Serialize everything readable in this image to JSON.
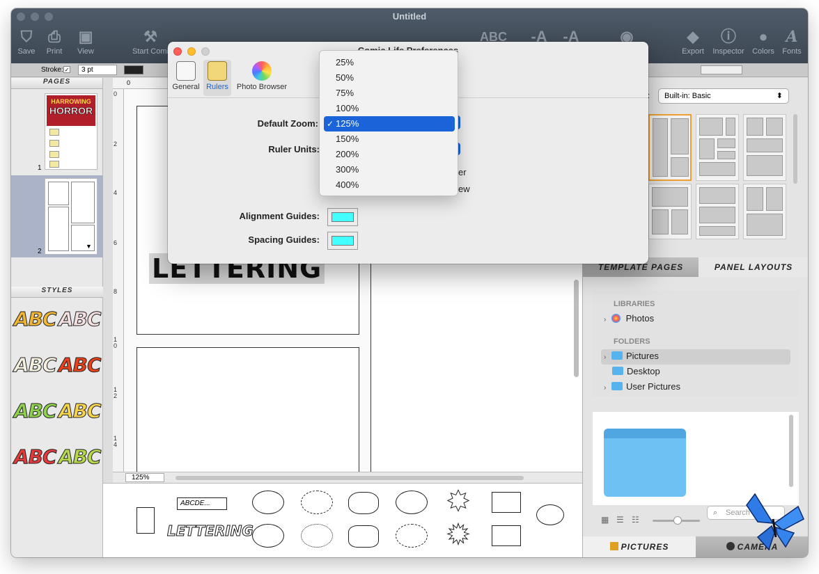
{
  "window": {
    "title": "Untitled"
  },
  "toolbar": {
    "save": "Save",
    "print": "Print",
    "view": "View",
    "start_comic": "Start Comi",
    "export": "Export",
    "inspector": "Inspector",
    "colors": "Colors",
    "fonts": "Fonts"
  },
  "stroke_bar": {
    "stroke_label": "Stroke:",
    "stroke_size": "3 pt"
  },
  "left_panel": {
    "pages_header": "PAGES",
    "page1_number": "1",
    "page2_number": "2",
    "page1_cover_text": "HARROWING",
    "page1_cover_title": "HORROR",
    "styles_header": "STYLES",
    "style_samples": [
      "ABC",
      "ABC",
      "ABC",
      "ABC",
      "ABC",
      "ABC",
      "ABC",
      "ABC"
    ]
  },
  "canvas": {
    "ruler_top_start": "0",
    "ruler_left_numbers": [
      "0",
      "2",
      "4",
      "6",
      "8",
      "1\n0",
      "1\n2",
      "1\n4"
    ],
    "lettering_text": "LETTERING",
    "zoom_value": "125%"
  },
  "tray": {
    "text_label": "ABCDE...",
    "lettering_text": "LETTERING"
  },
  "right_panel": {
    "layout_label": "t:",
    "layout_select": "Built-in: Basic",
    "tab_template_pages": "TEMPLATE PAGES",
    "tab_panel_layouts": "PANEL LAYOUTS",
    "libraries_header": "LIBRARIES",
    "photos": "Photos",
    "folders_header": "FOLDERS",
    "folder_pictures": "Pictures",
    "folder_desktop": "Desktop",
    "folder_user_pictures": "User Pictures",
    "search_placeholder": "Search",
    "tab_pictures": "PICTURES",
    "tab_camera": "CAMERA"
  },
  "preferences": {
    "title": "Comic Life Preferences",
    "tabs": [
      "General",
      "Rulers",
      "Photo Browser"
    ],
    "default_zoom_label": "Default Zoom:",
    "ruler_units_label": "Ruler Units:",
    "partial_text_1": "er",
    "partial_text_2": "ew",
    "alignment_guides_label": "Alignment Guides:",
    "spacing_guides_label": "Spacing Guides:",
    "guide_color": "#44ffff"
  },
  "zoom_menu": {
    "options": [
      "25%",
      "50%",
      "75%",
      "100%",
      "125%",
      "150%",
      "200%",
      "300%",
      "400%"
    ],
    "selected": "125%",
    "selected_index": 4,
    "check_mark": "✓"
  }
}
